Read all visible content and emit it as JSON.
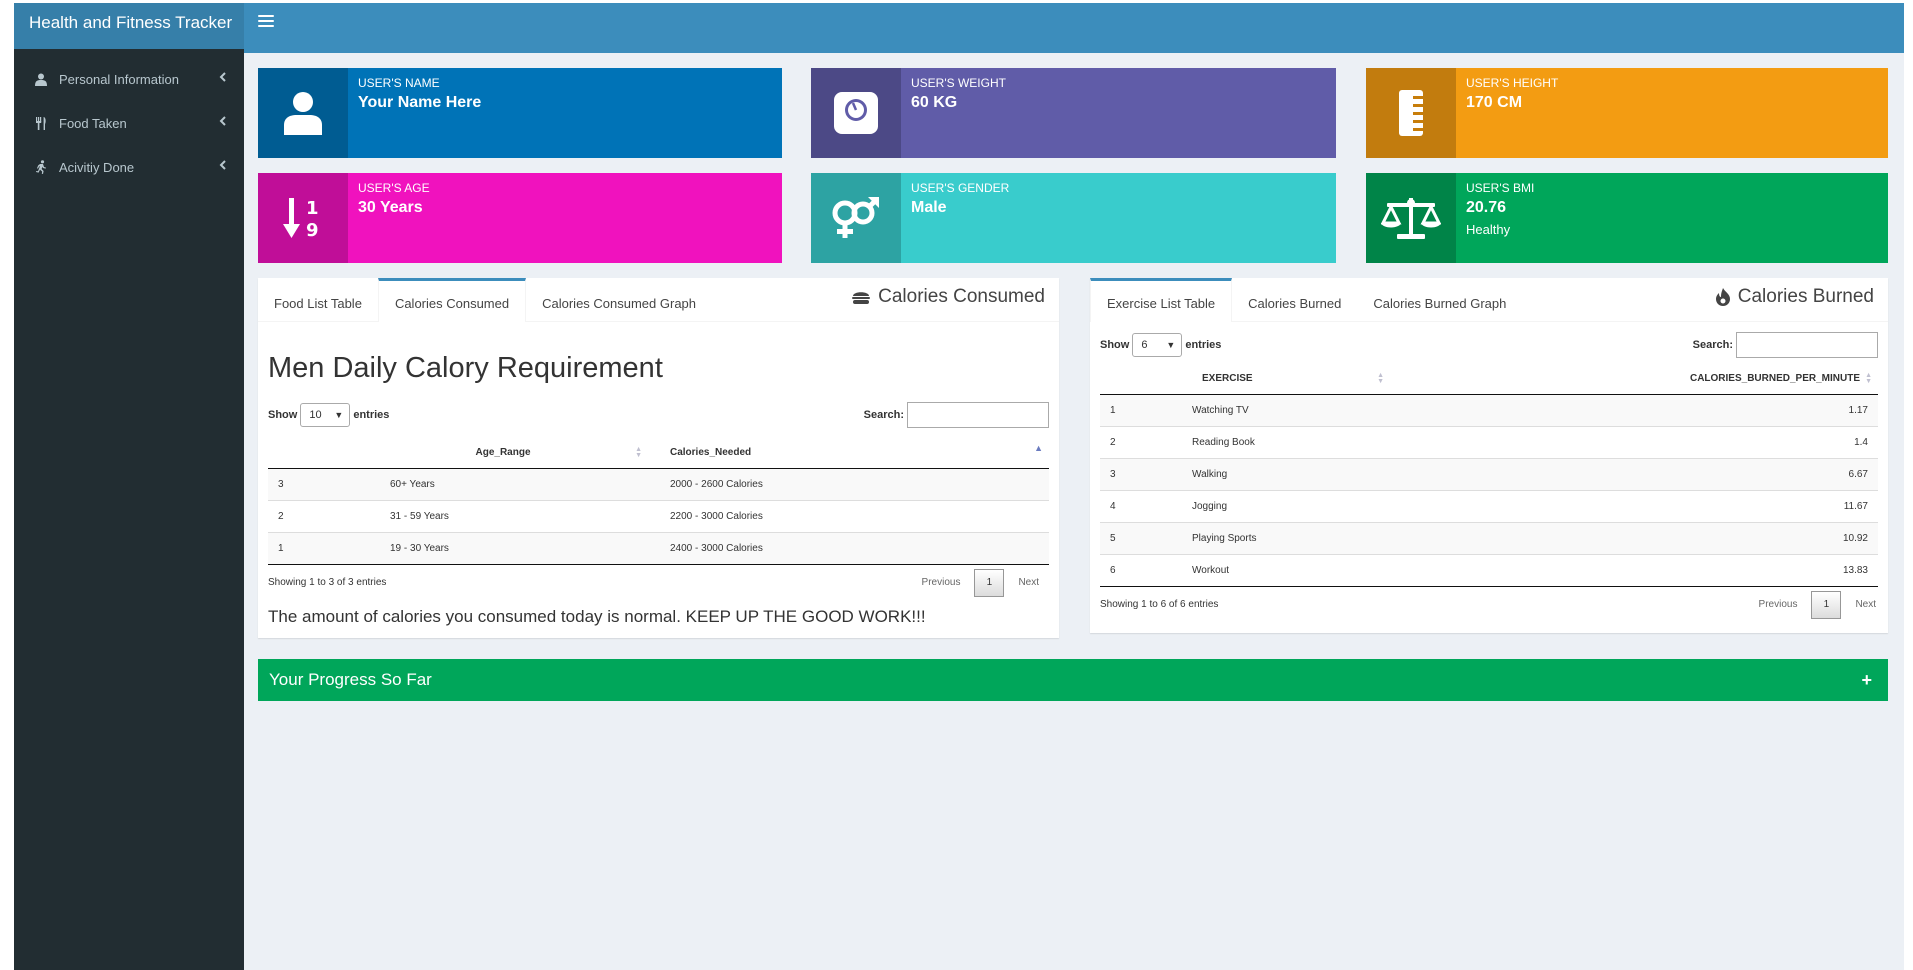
{
  "app": {
    "title": "Health and Fitness Tracker"
  },
  "sidebar": {
    "items": [
      {
        "label": "Personal Information",
        "icon": "user-icon"
      },
      {
        "label": "Food Taken",
        "icon": "cutlery-icon"
      },
      {
        "label": "Acivitiy Done",
        "icon": "running-icon"
      }
    ]
  },
  "cards": {
    "name": {
      "label": "USER'S NAME",
      "value": "Your Name Here",
      "color": "#0073b7",
      "icon": "user-icon"
    },
    "weight": {
      "label": "USER'S WEIGHT",
      "value": "60 KG",
      "color": "#605ca8",
      "icon": "weight-scale-icon"
    },
    "height": {
      "label": "USER'S HEIGHT",
      "value": "170 CM",
      "color": "#f39c12",
      "icon": "ruler-icon"
    },
    "age": {
      "label": "USER'S AGE",
      "value": "30 Years",
      "color": "#f012be",
      "icon": "sort-numeric-icon"
    },
    "gender": {
      "label": "USER'S GENDER",
      "value": "Male",
      "color": "#39cccc",
      "icon": "gender-icon"
    },
    "bmi": {
      "label": "USER'S BMI",
      "value": "20.76",
      "sub": "Healthy",
      "color": "#00a65a",
      "icon": "balance-scale-icon"
    }
  },
  "calories_box": {
    "tabs": [
      "Food List Table",
      "Calories Consumed",
      "Calories Consumed Graph"
    ],
    "active_tab": 1,
    "header": "Calories Consumed",
    "section_title": "Men Daily Calory Requirement",
    "show_label": "Show",
    "entries_label": "entries",
    "page_size": "10",
    "search_label": "Search:",
    "columns": [
      "",
      "Age_Range",
      "Calories_Needed"
    ],
    "rows": [
      [
        "3",
        "60+ Years",
        "2000 - 2600 Calories"
      ],
      [
        "2",
        "31 - 59 Years",
        "2200 - 3000 Calories"
      ],
      [
        "1",
        "19 - 30 Years",
        "2400 - 3000 Calories"
      ]
    ],
    "info": "Showing 1 to 3 of 3 entries",
    "prev": "Previous",
    "page": "1",
    "next": "Next",
    "message": "The amount of calories you consumed today is normal. KEEP UP THE GOOD WORK!!!"
  },
  "exercise_box": {
    "tabs": [
      "Exercise List Table",
      "Calories Burned",
      "Calories Burned Graph"
    ],
    "active_tab": 0,
    "header": "Calories Burned",
    "show_label": "Show",
    "entries_label": "entries",
    "page_size": "6",
    "search_label": "Search:",
    "columns": [
      "",
      "EXERCISE",
      "CALORIES_BURNED_PER_MINUTE"
    ],
    "rows": [
      [
        "1",
        "Watching TV",
        "1.17"
      ],
      [
        "2",
        "Reading Book",
        "1.4"
      ],
      [
        "3",
        "Walking",
        "6.67"
      ],
      [
        "4",
        "Jogging",
        "11.67"
      ],
      [
        "5",
        "Playing Sports",
        "10.92"
      ],
      [
        "6",
        "Workout",
        "13.83"
      ]
    ],
    "info": "Showing 1 to 6 of 6 entries",
    "prev": "Previous",
    "page": "1",
    "next": "Next"
  },
  "progress": {
    "title": "Your Progress So Far"
  }
}
